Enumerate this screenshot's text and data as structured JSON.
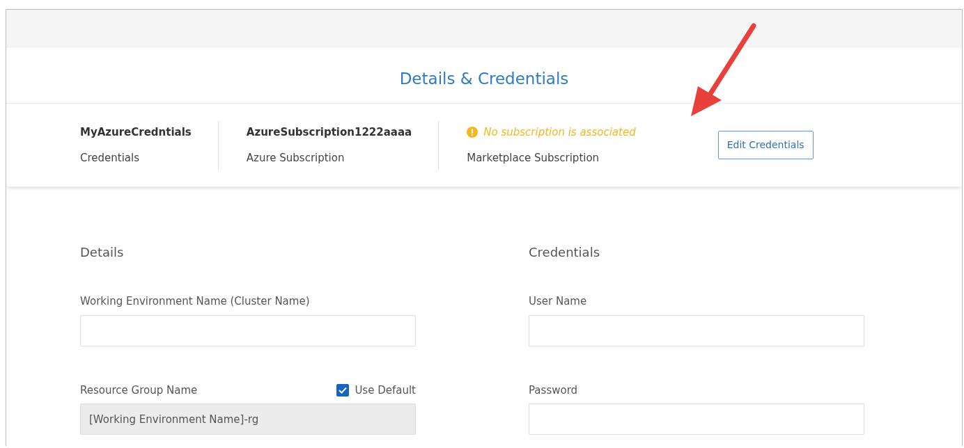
{
  "title": "Details & Credentials",
  "summary": [
    {
      "value": "MyAzureCredntials",
      "label": "Credentials",
      "kind": "plain"
    },
    {
      "value": "AzureSubscription1222aaaa",
      "label": "Azure Subscription",
      "kind": "plain"
    },
    {
      "value": "No subscription is associated",
      "label": "Marketplace Subscription",
      "kind": "warning"
    }
  ],
  "edit_button": "Edit Credentials",
  "sections": [
    {
      "heading": "Details",
      "fields": [
        {
          "label": "Working Environment Name (Cluster Name)",
          "disabled": false
        },
        {
          "label": "Resource Group Name",
          "value": "[Working Environment Name]-rg",
          "disabled": true,
          "checkbox": {
            "label": "Use Default",
            "checked": true
          }
        }
      ]
    },
    {
      "heading": "Credentials",
      "fields": [
        {
          "label": "User Name",
          "disabled": false
        },
        {
          "label": "Password",
          "disabled": false
        }
      ]
    }
  ]
}
